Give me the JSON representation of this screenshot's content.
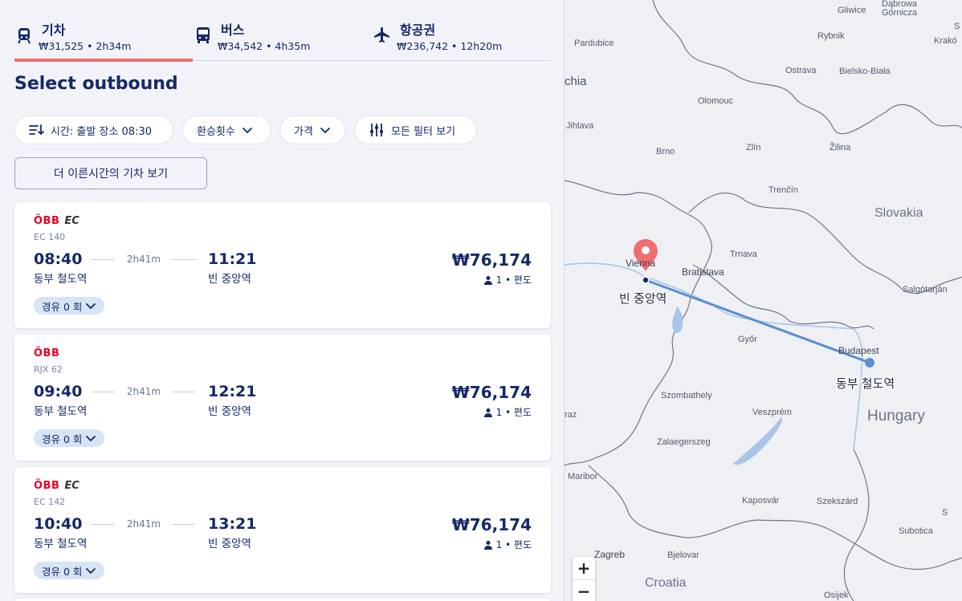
{
  "tabs": [
    {
      "name": "기차",
      "info": "₩31,525 • 2h34m",
      "icon": "train-icon",
      "active": true
    },
    {
      "name": "버스",
      "info": "₩34,542 • 4h35m",
      "icon": "bus-icon",
      "active": false
    },
    {
      "name": "항공권",
      "info": "₩236,742 • 12h20m",
      "icon": "plane-icon",
      "active": false
    }
  ],
  "title": "Select outbound",
  "filters": {
    "sort_label": "시간: 출발 장소 08:30",
    "transfers_label": "환승횟수",
    "price_label": "가격",
    "all_filters_label": "모든 필터 보기"
  },
  "earlier_button": "더 이른시간의 기차 보기",
  "results": [
    {
      "operator": "ÖBB",
      "brand": "EC",
      "train_number": "EC 140",
      "dep_time": "08:40",
      "duration": "2h41m",
      "arr_time": "11:21",
      "dep_station": "동부 철도역",
      "arr_station": "빈 중앙역",
      "price": "₩76,174",
      "passengers": "1 • 편도",
      "stops": "경유 0 회"
    },
    {
      "operator": "ÖBB",
      "brand": "",
      "train_number": "RJX 62",
      "dep_time": "09:40",
      "duration": "2h41m",
      "arr_time": "12:21",
      "dep_station": "동부 철도역",
      "arr_station": "빈 중앙역",
      "price": "₩76,174",
      "passengers": "1 • 편도",
      "stops": "경유 0 회"
    },
    {
      "operator": "ÖBB",
      "brand": "EC",
      "train_number": "EC 142",
      "dep_time": "10:40",
      "duration": "2h41m",
      "arr_time": "13:21",
      "dep_station": "동부 철도역",
      "arr_station": "빈 중앙역",
      "price": "₩76,174",
      "passengers": "1 • 편도",
      "stops": "경유 0 회"
    }
  ],
  "map": {
    "origin_label": "빈 중앙역",
    "destination_label": "동부 철도역",
    "route_color": "#5b8fd0",
    "pin_color": "#f06e6e",
    "places": {
      "gliwice": "Gliwice",
      "dabrowa": "Dąbrowa",
      "gornicza": "Górnicza",
      "pardubice": "Pardubice",
      "rybnik": "Rybnik",
      "krakow": "Krakó",
      "ostrava": "Ostrava",
      "bielsko": "Bielsko-Biała",
      "chia": "chia",
      "olomouc": "Olomouc",
      "jihlava": "Jihlava",
      "brno": "Brno",
      "zlin": "Zlín",
      "zilina": "Žilina",
      "trencin": "Trenčín",
      "slovakia": "Slovakia",
      "trnava": "Trnava",
      "vienna": "Vienna",
      "bratislava": "Bratislava",
      "salgotarjan": "Salgótarján",
      "gyor": "Győr",
      "budapest": "Budapest",
      "szombathely": "Szombathely",
      "raz": "raz",
      "veszprem": "Veszprém",
      "hungary": "Hungary",
      "zalaegerszeg": "Zalaegerszeg",
      "maribor": "Maribor",
      "kaposvar": "Kaposvár",
      "szekszard": "Szekszárd",
      "subotica": "Subotica",
      "zagreb": "Zagreb",
      "bjelovar": "Bjelovar",
      "croatia": "Croatia",
      "osijek": "Osijek",
      "s1": "S",
      "s2": "S"
    },
    "zoom_in": "+",
    "zoom_out": "−"
  }
}
